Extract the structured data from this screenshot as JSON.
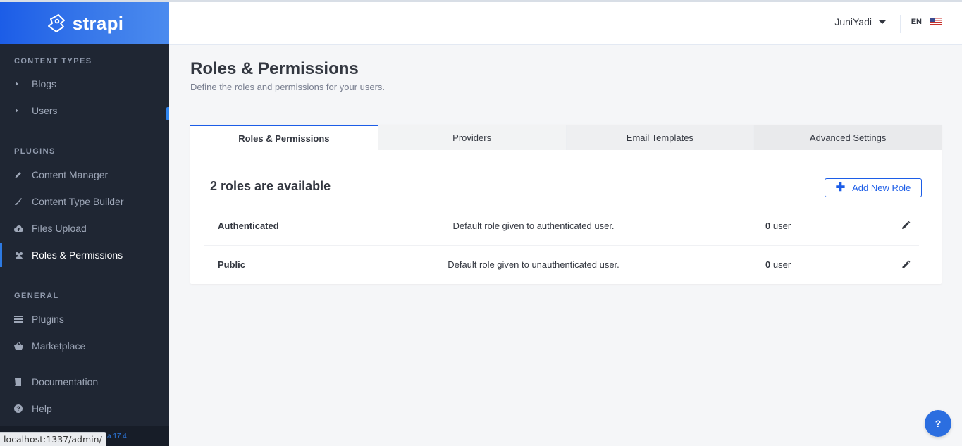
{
  "brand": {
    "name": "strapi"
  },
  "sidebar": {
    "sections": [
      {
        "title": "CONTENT TYPES",
        "items": [
          {
            "label": "Blogs",
            "icon": "caret-right-icon"
          },
          {
            "label": "Users",
            "icon": "caret-right-icon"
          }
        ]
      },
      {
        "title": "PLUGINS",
        "items": [
          {
            "label": "Content Manager",
            "icon": "pencil-tool-icon"
          },
          {
            "label": "Content Type Builder",
            "icon": "brush-icon"
          },
          {
            "label": "Files Upload",
            "icon": "cloud-upload-icon"
          },
          {
            "label": "Roles & Permissions",
            "icon": "users-icon",
            "active": true
          }
        ]
      },
      {
        "title": "GENERAL",
        "items": [
          {
            "label": "Plugins",
            "icon": "list-icon"
          },
          {
            "label": "Marketplace",
            "icon": "basket-icon"
          },
          {
            "label": "Documentation",
            "icon": "book-icon"
          },
          {
            "label": "Help",
            "icon": "question-circle-icon"
          }
        ]
      }
    ],
    "version": "a.17.4",
    "status_url": "localhost:1337/admin/"
  },
  "header": {
    "username": "JuniYadi",
    "language": "EN",
    "flag_icon": "us-flag-icon"
  },
  "main": {
    "title": "Roles & Permissions",
    "subtitle": "Define the roles and permissions for your users.",
    "tabs": [
      {
        "label": "Roles & Permissions",
        "active": true
      },
      {
        "label": "Providers"
      },
      {
        "label": "Email Templates"
      },
      {
        "label": "Advanced Settings"
      }
    ],
    "roles_count_label": "2 roles are available",
    "add_button_label": "Add New Role",
    "roles": [
      {
        "name": "Authenticated",
        "description": "Default role given to authenticated user.",
        "count": "0",
        "count_unit": "user"
      },
      {
        "name": "Public",
        "description": "Default role given to unauthenticated user.",
        "count": "0",
        "count_unit": "user"
      }
    ]
  },
  "help_button_label": "?",
  "colors": {
    "accent": "#1c5de7",
    "sidebar_bg": "#1f2633",
    "page_bg": "#f5f6f8"
  }
}
